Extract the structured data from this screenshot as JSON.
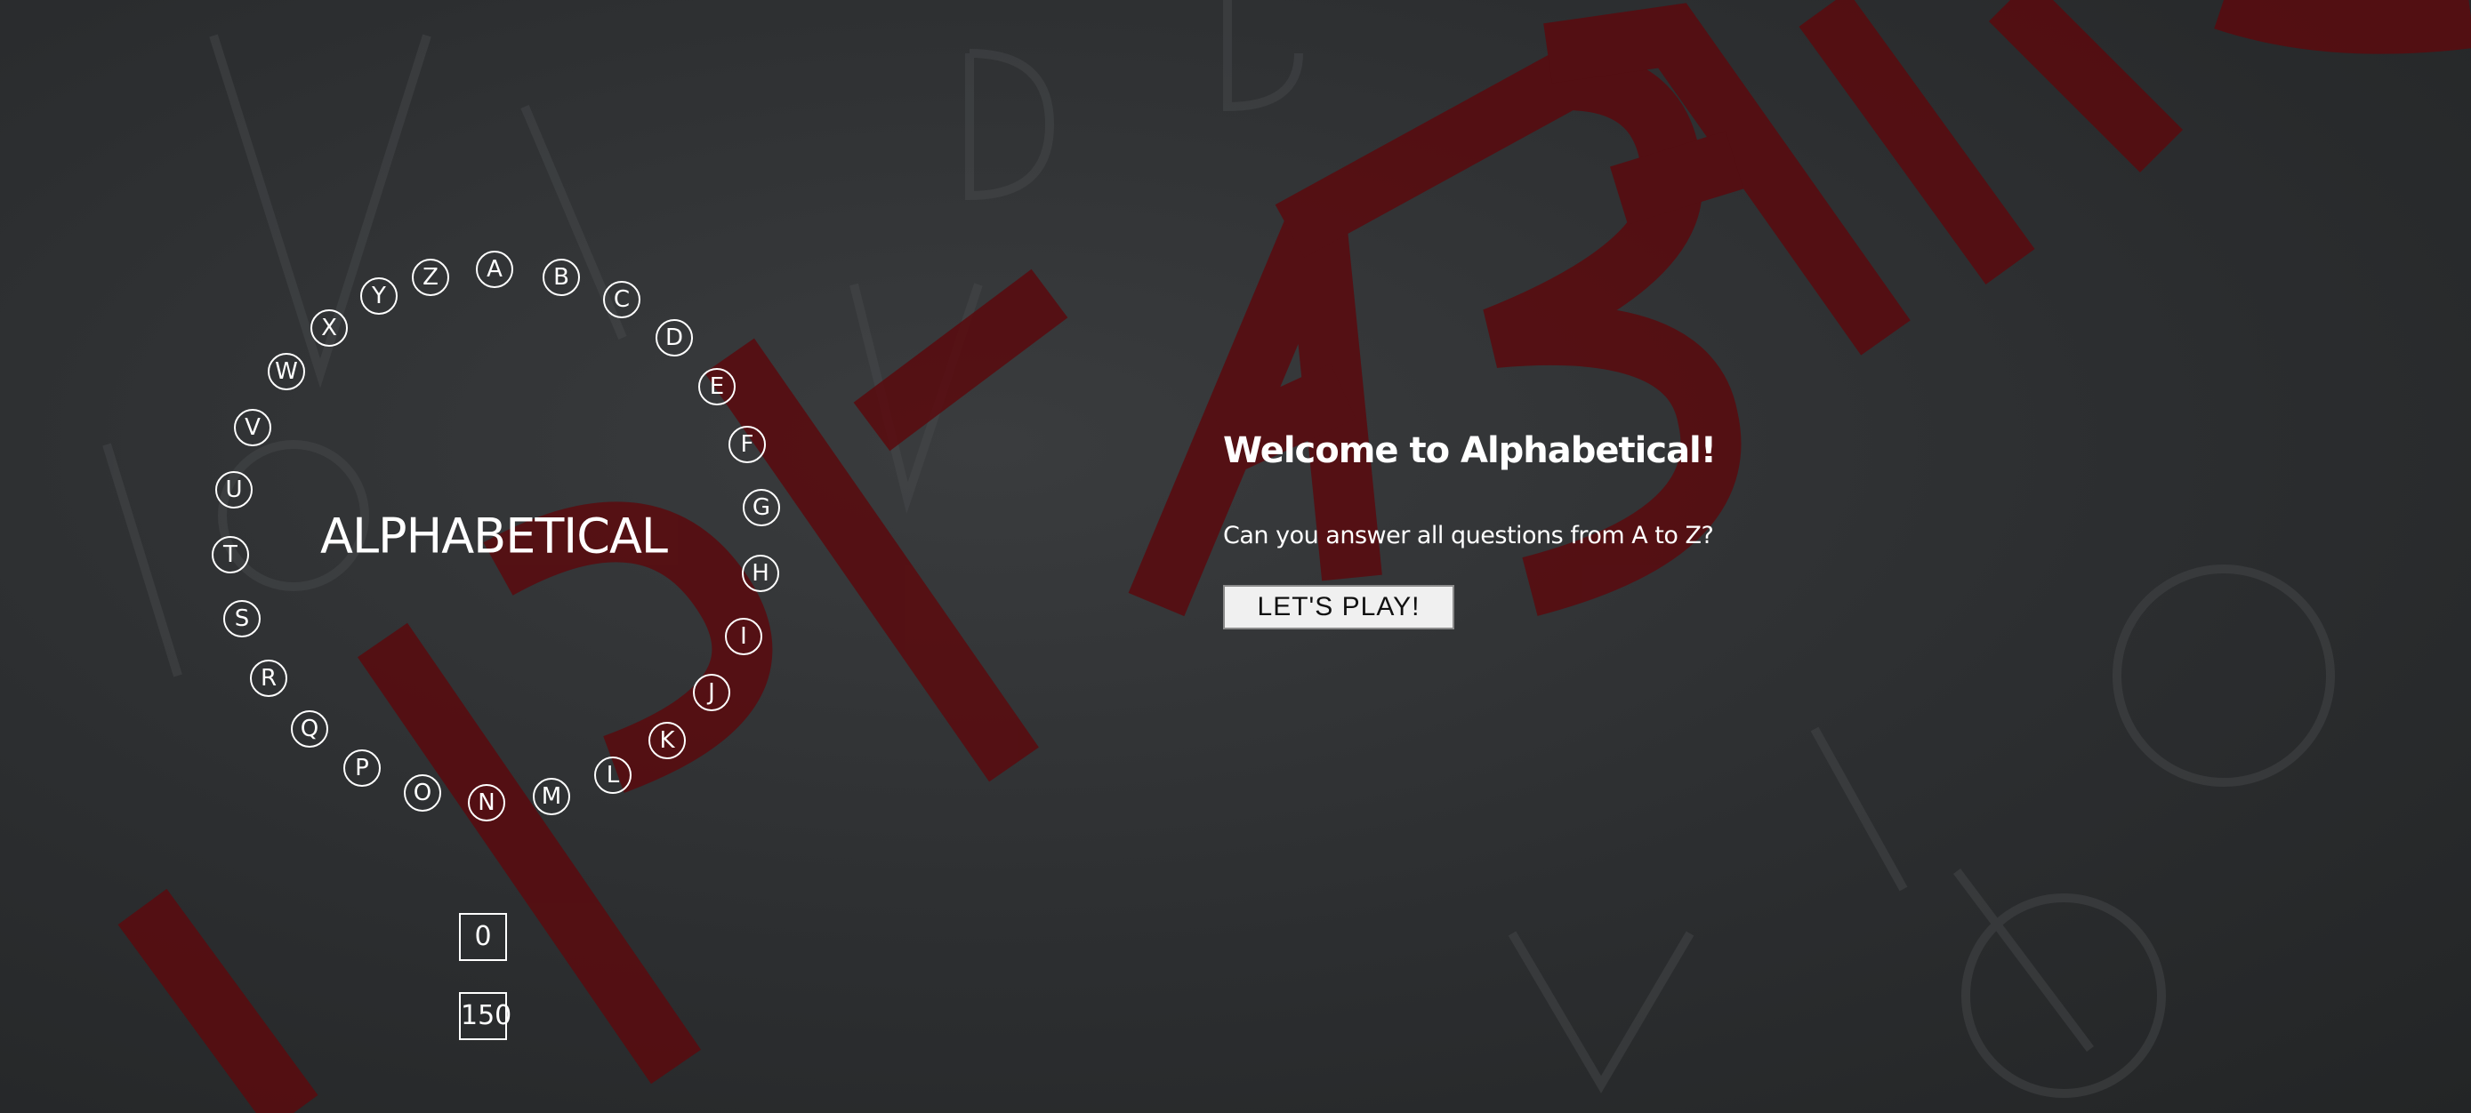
{
  "ring": {
    "letters": [
      "A",
      "B",
      "C",
      "D",
      "E",
      "F",
      "G",
      "H",
      "I",
      "J",
      "K",
      "L",
      "M",
      "N",
      "O",
      "P",
      "Q",
      "R",
      "S",
      "T",
      "U",
      "V",
      "W",
      "X",
      "Y",
      "Z"
    ]
  },
  "title": "ALPHABETICAL",
  "counters": {
    "score": "0",
    "time": "150"
  },
  "welcome": {
    "heading": "Welcome to Alphabetical!",
    "question": "Can you answer all questions from A to Z?",
    "play_label": "LET'S PLAY!"
  },
  "colors": {
    "text": "#ffffff",
    "background": "#2c2e30",
    "background_lettering": "#5a0a0e"
  }
}
